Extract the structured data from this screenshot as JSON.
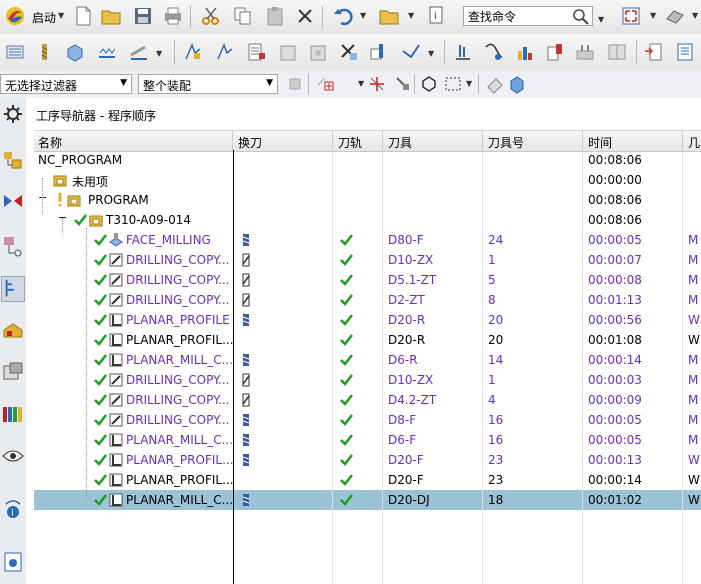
{
  "toolbar": {
    "start_label": "启动",
    "search_placeholder": "查找命令"
  },
  "filterbar": {
    "filter_value": "无选择过滤器",
    "assembly_value": "整个装配"
  },
  "panel": {
    "title": "工序导航器 - 程序顺序"
  },
  "columns": {
    "name": "名称",
    "tool_change": "换刀",
    "path": "刀轨",
    "tool": "刀具",
    "tool_number": "刀具号",
    "time": "时间",
    "geometry": "几"
  },
  "tree": {
    "root": {
      "name": "NC_PROGRAM",
      "time": "00:08:06"
    },
    "unused": {
      "name": "未用项",
      "time": "00:00:00"
    },
    "program": {
      "name": "PROGRAM",
      "time": "00:08:06"
    },
    "group": {
      "name": "T310-A09-014",
      "time": "00:08:06"
    }
  },
  "operations": [
    {
      "name": "FACE_MILLING",
      "tool": "D80-F",
      "tool_number": "24",
      "time": "00:00:05",
      "geom": "M",
      "color": "purple",
      "type": "face",
      "tc": "endmill"
    },
    {
      "name": "DRILLING_COPY...",
      "tool": "D10-ZX",
      "tool_number": "1",
      "time": "00:00:07",
      "geom": "M",
      "color": "purple",
      "type": "drill",
      "tc": "drill"
    },
    {
      "name": "DRILLING_COPY...",
      "tool": "D5.1-ZT",
      "tool_number": "5",
      "time": "00:00:08",
      "geom": "M",
      "color": "purple",
      "type": "drill",
      "tc": "drill"
    },
    {
      "name": "DRILLING_COPY...",
      "tool": "D2-ZT",
      "tool_number": "8",
      "time": "00:01:13",
      "geom": "M",
      "color": "purple",
      "type": "drill",
      "tc": "drill"
    },
    {
      "name": "PLANAR_PROFILE",
      "tool": "D20-R",
      "tool_number": "20",
      "time": "00:00:56",
      "geom": "W",
      "color": "purple",
      "type": "planar",
      "tc": "endmill"
    },
    {
      "name": "PLANAR_PROFIL...",
      "tool": "D20-R",
      "tool_number": "20",
      "time": "00:01:08",
      "geom": "W",
      "color": "black",
      "type": "planar",
      "tc": ""
    },
    {
      "name": "PLANAR_MILL_C...",
      "tool": "D6-R",
      "tool_number": "14",
      "time": "00:00:14",
      "geom": "M",
      "color": "purple",
      "type": "planar",
      "tc": "endmill"
    },
    {
      "name": "DRILLING_COPY...",
      "tool": "D10-ZX",
      "tool_number": "1",
      "time": "00:00:03",
      "geom": "M",
      "color": "purple",
      "type": "drill",
      "tc": "drill"
    },
    {
      "name": "DRILLING_COPY...",
      "tool": "D4.2-ZT",
      "tool_number": "4",
      "time": "00:00:09",
      "geom": "M",
      "color": "purple",
      "type": "drill",
      "tc": "drill"
    },
    {
      "name": "DRILLING_COPY...",
      "tool": "D8-F",
      "tool_number": "16",
      "time": "00:00:05",
      "geom": "M",
      "color": "purple",
      "type": "drill",
      "tc": "endmill"
    },
    {
      "name": "PLANAR_MILL_C...",
      "tool": "D6-F",
      "tool_number": "16",
      "time": "00:00:05",
      "geom": "M",
      "color": "purple",
      "type": "planar",
      "tc": "endmill"
    },
    {
      "name": "PLANAR_PROFIL...",
      "tool": "D20-F",
      "tool_number": "23",
      "time": "00:00:13",
      "geom": "W",
      "color": "purple",
      "type": "planar",
      "tc": "endmill"
    },
    {
      "name": "PLANAR_PROFIL...",
      "tool": "D20-F",
      "tool_number": "23",
      "time": "00:00:14",
      "geom": "W",
      "color": "black",
      "type": "planar",
      "tc": ""
    },
    {
      "name": "PLANAR_MILL_C...",
      "tool": "D20-DJ",
      "tool_number": "18",
      "time": "00:01:02",
      "geom": "W",
      "color": "black",
      "type": "planar",
      "tc": "endmill",
      "selected": true
    }
  ],
  "icons": {
    "app_menu": "ug-logo-icon",
    "new": "new-file-icon",
    "open": "open-folder-icon",
    "save": "save-icon",
    "print": "print-icon",
    "cut": "cut-icon",
    "copy": "copy-icon",
    "paste": "paste-icon",
    "delete": "delete-icon",
    "undo": "undo-icon",
    "search": "magnifier-icon",
    "settings": "gear-icon"
  },
  "colors": {
    "purple_text": "#6a2fb8",
    "check_green": "#1aa01a",
    "selection": "#9ac4d5"
  }
}
